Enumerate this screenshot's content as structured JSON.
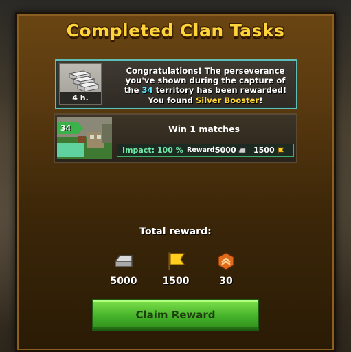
{
  "dialog": {
    "title": "Completed Clan Tasks"
  },
  "congrats": {
    "booster_time": "4 h.",
    "line1": "Congratulations! The perseverance",
    "line2": "you've shown during the capture of",
    "line3_prefix": "the ",
    "territory": "34",
    "line3_suffix": " territory has been rewarded!",
    "line4_prefix": "You found ",
    "booster_name": "Silver Booster",
    "line4_suffix": "!"
  },
  "task": {
    "level": "34",
    "title": "Win 1 matches",
    "impact_label": "Impact: 100 %",
    "reward_label": "Reward:",
    "reward_silver": "5000",
    "reward_flags": "1500"
  },
  "total": {
    "label": "Total reward:",
    "silver": "5000",
    "flags": "1500",
    "rank": "30"
  },
  "claim_button": "Claim Reward",
  "colors": {
    "title_gold": "#ffd43b",
    "accent_cyan": "#5fe8ff",
    "button_green": "#45b22a",
    "impact_green": "#6fe8a6"
  },
  "icons": {
    "silver": "silver-bars-icon",
    "flag": "flag-icon",
    "rank": "rank-chevron-icon",
    "booster": "silver-booster-icon"
  }
}
